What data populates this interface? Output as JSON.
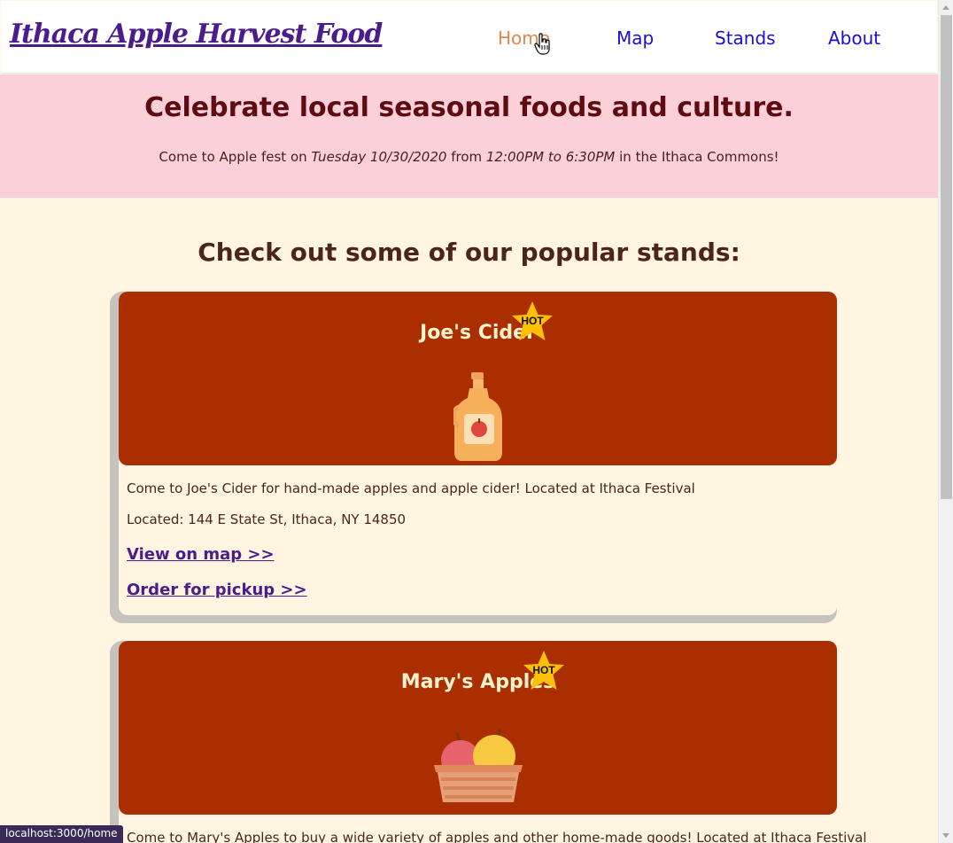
{
  "navbar": {
    "brand": "Ithaca Apple Harvest Food",
    "links": [
      {
        "label": "Home",
        "active": true
      },
      {
        "label": "Map",
        "active": false
      },
      {
        "label": "Stands",
        "active": false
      },
      {
        "label": "About",
        "active": false
      }
    ]
  },
  "hero": {
    "title": "Celebrate local seasonal foods and culture.",
    "sub_prefix": "Come to Apple fest on ",
    "sub_date": "Tuesday 10/30/2020",
    "sub_mid": " from ",
    "sub_time": "12:00PM to 6:30PM",
    "sub_suffix": " in the Ithaca Commons!"
  },
  "section_title": "Check out some of our popular stands:",
  "stands": [
    {
      "name": "Joe's Cider",
      "badge": "HOT",
      "icon": "cider-jug-icon",
      "description": "Come to Joe's Cider for hand-made apples and apple cider! Located at Ithaca Festival",
      "located": "Located: 144 E State St, Ithaca, NY 14850",
      "map_link": "View on map >>",
      "order_link": "Order for pickup >>"
    },
    {
      "name": "Mary's Apples",
      "badge": "HOT",
      "icon": "apple-basket-icon",
      "description": "Come to Mary's Apples to buy a wide variety of apples and other home-made goods! Located at Ithaca Festival"
    }
  ],
  "status_bar": {
    "url": "localhost:3000/home"
  },
  "colors": {
    "brand": "#4a1c8c",
    "nav_link": "#1a0dd6",
    "nav_active": "#e0874a",
    "hero_bg": "#fbd0d9",
    "page_bg": "#fff5e1",
    "card_header": "#ab2e00",
    "badge": "#ffc107"
  }
}
